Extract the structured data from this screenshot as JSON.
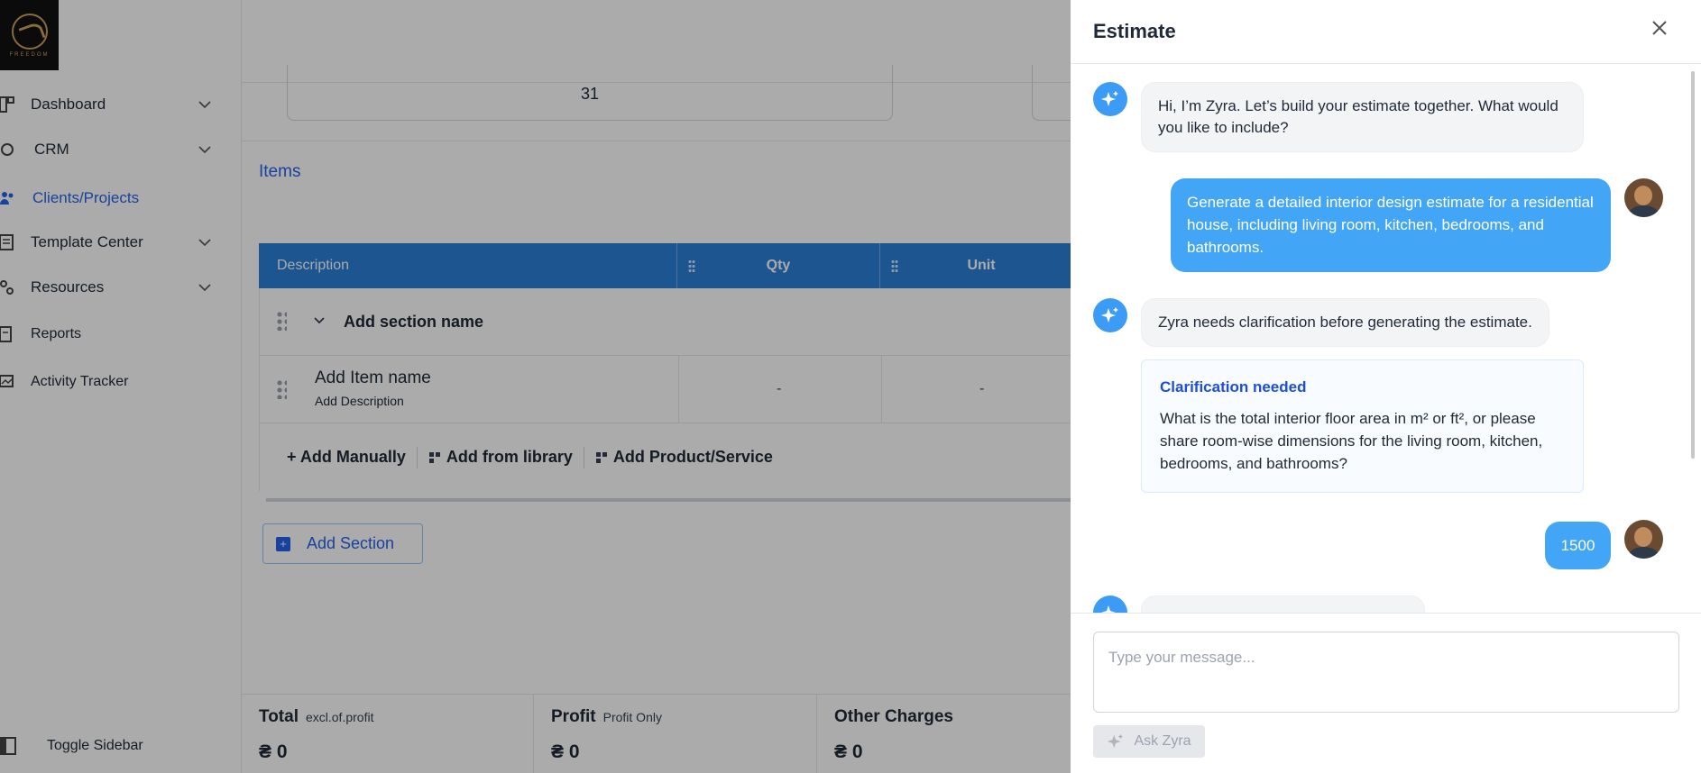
{
  "brand": {
    "logo_text": "FREEDOM"
  },
  "sidebar": {
    "items": [
      {
        "label": "Dashboard",
        "has_chevron": true
      },
      {
        "label": "CRM",
        "has_chevron": true
      },
      {
        "label": "Clients/Projects",
        "active": true
      },
      {
        "label": "Template Center",
        "has_chevron": true
      },
      {
        "label": "Resources",
        "has_chevron": true
      },
      {
        "label": "Reports"
      },
      {
        "label": "Activity Tracker"
      }
    ],
    "toggle_label": "Toggle Sidebar"
  },
  "main": {
    "date_value": "31",
    "items_title": "Items",
    "table": {
      "headers": {
        "description": "Description",
        "qty": "Qty",
        "unit": "Unit"
      },
      "section_name": "Add section name",
      "item_name": "Add Item name",
      "item_description": "Add Description",
      "qty_value": "-",
      "unit_value": "-"
    },
    "actions": {
      "add_manually": "+ Add Manually",
      "add_library": "Add from library",
      "add_product": "Add Product/Service"
    },
    "add_section": "Add Section",
    "footer": {
      "total_label": "Total",
      "total_sub": "excl.of.profit",
      "total_value": "₴ 0",
      "profit_label": "Profit",
      "profit_sub": "Profit Only",
      "profit_value": "₴ 0",
      "other_label": "Other Charges",
      "other_value": "₴ 0"
    }
  },
  "drawer": {
    "title": "Estimate",
    "messages": {
      "bot1": "Hi, I’m Zyra. Let’s build your estimate together. What would you like to include?",
      "user1": "Generate a detailed interior design estimate for a residential house, including living room, kitchen, bedrooms, and bathrooms.",
      "bot2": "Zyra needs clarification before generating the estimate.",
      "clar_title": "Clarification needed",
      "clar_text": "What is the total interior floor area in m² or ft², or please share room-wise dimensions for the living room, kitchen, bedrooms, and bathrooms?",
      "user2": "1500"
    },
    "input_placeholder": "Type your message...",
    "ask_button": "Ask Zyra"
  },
  "colors": {
    "accent": "#2b7fd6",
    "user_bubble": "#42a5f5",
    "link": "#2563eb"
  }
}
